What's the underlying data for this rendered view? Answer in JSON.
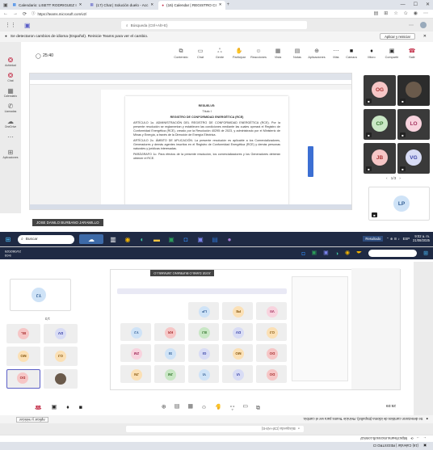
{
  "browser": {
    "tabs": [
      {
        "label": "Calendario: LISETT RODRIGUEZ I"
      },
      {
        "label": "(17) Chat | Solución duelo - Acc"
      },
      {
        "label": "(16) Calendar | REGISTRO CI"
      }
    ],
    "url": "https://teams.microsoft.com/v2/"
  },
  "teams": {
    "search_placeholder": "Búsqueda (Ctrl+Alt+E)",
    "notice": "Se detectaron cambios de idioma (Español). Reinicie Teams para ver el cambio.",
    "notice_btn": "Aplicar y reiniciar",
    "timer": "25:40",
    "rail": [
      "Actividad",
      "Chat",
      "Calendario",
      "Llamadas",
      "OneDrive",
      "Aplicaciones"
    ],
    "rail_top": "Actividad",
    "toolbar": [
      "Contenido",
      "Chat",
      "Gente",
      "Participar",
      "Reacciones",
      "Vista",
      "Notas",
      "Aplicaciones",
      "Más"
    ],
    "controls": [
      "Cámara",
      "Micro",
      "Compartir",
      "Salir"
    ],
    "participants": [
      {
        "initials": "OG",
        "color": "#f6c6c6",
        "text_color": "#a33"
      },
      {
        "initials": "CP",
        "color": "#c9e7c5",
        "text_color": "#3a7a33"
      },
      {
        "initials": "LO",
        "color": "#f8d3de",
        "text_color": "#a43360"
      },
      {
        "initials": "JB",
        "color": "#f6c6c6",
        "text_color": "#a33"
      },
      {
        "initials": "VG",
        "color": "#d8dcf5",
        "text_color": "#3b44a8"
      },
      {
        "initials": "LP",
        "color": "#cfe3f7",
        "text_color": "#2e5b92"
      }
    ],
    "pager": "1/3",
    "presenter": "JOSE DANILO BURBANO JARAMILLO",
    "doc": {
      "heading": "RESUELVE:",
      "sub": "Título I",
      "section": "REGISTRO DE CONFORMIDAD ENERGÉTICA (RCE)",
      "p1": "ARTÍCULO 1o. ADMINISTRACIÓN DEL REGISTRO DE CONFORMIDAD ENERGÉTICA (RCE). Por la presente resolución se reglamentan y establecen las condiciones mediante las cuales operará el Registro de Conformidad Energética (RCE), creado por la Resolución 40295 de 2023, y administrado por el Ministerio de Minas y Energía, a través de la Dirección de Energía Eléctrica.",
      "p2": "ARTÍCULO 2o. ÁMBITO DE APLICACIÓN. La presente resolución es aplicable a los Comercializadores, Generadores y demás agentes inscritos en el Registro de Conformidad Energética (RCE) y demás personas naturales y jurídicas interesadas.",
      "p3": "PARÁGRAFO 1o. Para efectos de la presente resolución, los comercializadores y los Generadores deberán obtener el RCE."
    }
  },
  "taskbar": {
    "search": "Buscar",
    "result": "Resultado",
    "lang": "ESP",
    "time": "9:02 a. m.",
    "date": "21/08/2025"
  },
  "mirror": {
    "url": "https://teams.microsoft.com/v2/",
    "tab_label": "(16) Calendar | REGISTRO CI",
    "search": "Búsqueda (Ctrl+Alt+E)",
    "notice": "Se detectaron cambios de idioma (Español). Reinicie Teams para ver el cambio.",
    "notice_btn": "Aplicar y reiniciar",
    "timer": "25:09",
    "left_tiles": [
      {
        "initials": "DO",
        "color": "#f6c6c6"
      },
      {
        "initials": "OJ",
        "color": "#fbe0b5"
      },
      {
        "initials": "MO",
        "color": "#fbe0b5"
      },
      {
        "initials": "DV",
        "color": "#d8dcf5"
      },
      {
        "initials": "BL",
        "color": "#f6c6c6"
      },
      {
        "initials": "YJ",
        "color": "#cfe3f7"
      }
    ],
    "pager": "1/3",
    "grid": [
      "DO",
      "VI",
      "YI",
      "JM",
      "JN",
      "DO",
      "MO",
      "GI",
      "SI",
      "ZM",
      "OJ",
      "DV",
      "BJ",
      "KR",
      "YJ",
      "VII",
      "PE",
      "LP"
    ],
    "presenter": "JOSE DANILO BURBANO JARAMILLO",
    "time": "9:03",
    "date": "21/08/2025"
  },
  "colors": {
    "teams_purple": "#5b5fc7",
    "taskbar": "#1f2a44",
    "tile": "#3a3a3a",
    "leave": "#c4314b"
  }
}
